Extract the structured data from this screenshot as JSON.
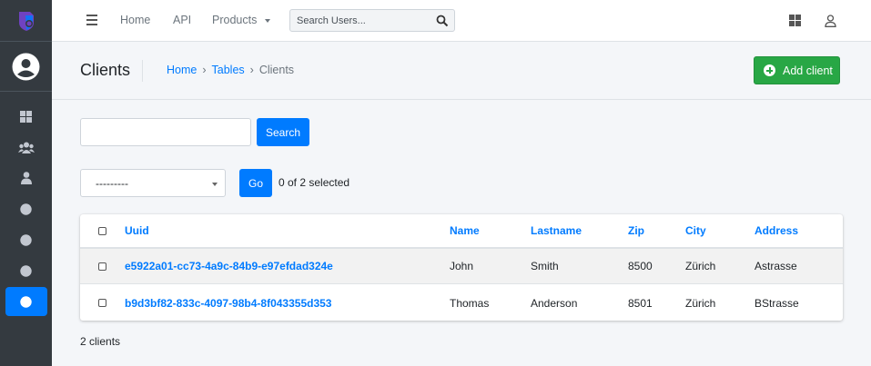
{
  "topnav": {
    "home": "Home",
    "api": "API",
    "products": "Products",
    "search_placeholder": "Search Users..."
  },
  "header": {
    "title": "Clients",
    "breadcrumb": [
      "Home",
      "Tables",
      "Clients"
    ],
    "breadcrumb_sep": "›",
    "add_button": "Add client"
  },
  "filters": {
    "search_value": "",
    "search_button": "Search",
    "action_select": "---------",
    "go_button": "Go",
    "selected_count": "0 of 2 selected"
  },
  "table": {
    "columns": [
      "Uuid",
      "Name",
      "Lastname",
      "Zip",
      "City",
      "Address"
    ],
    "rows": [
      [
        "e5922a01-cc73-4a9c-84b9-e97efdad324e",
        "John",
        "Smith",
        "8500",
        "Zürich",
        "Astrasse"
      ],
      [
        "b9d3bf82-833c-4097-98b4-8f043355d353",
        "Thomas",
        "Anderson",
        "8501",
        "Zürich",
        "BStrasse"
      ]
    ]
  },
  "footer": {
    "count": "2 clients"
  },
  "colors": {
    "sidebar": "#343a40",
    "primary": "#007bff",
    "success": "#28a745",
    "active_nav": "#007bff"
  },
  "icons": {
    "brand": "shield-logo-icon",
    "user": "user-avatar-icon",
    "nav": [
      "dashboard-icon",
      "users-icon",
      "user-icon",
      "circle-icon",
      "circle-icon",
      "circle-icon",
      "circle-icon"
    ],
    "top_right": [
      "grid-icon",
      "user-icon"
    ]
  }
}
